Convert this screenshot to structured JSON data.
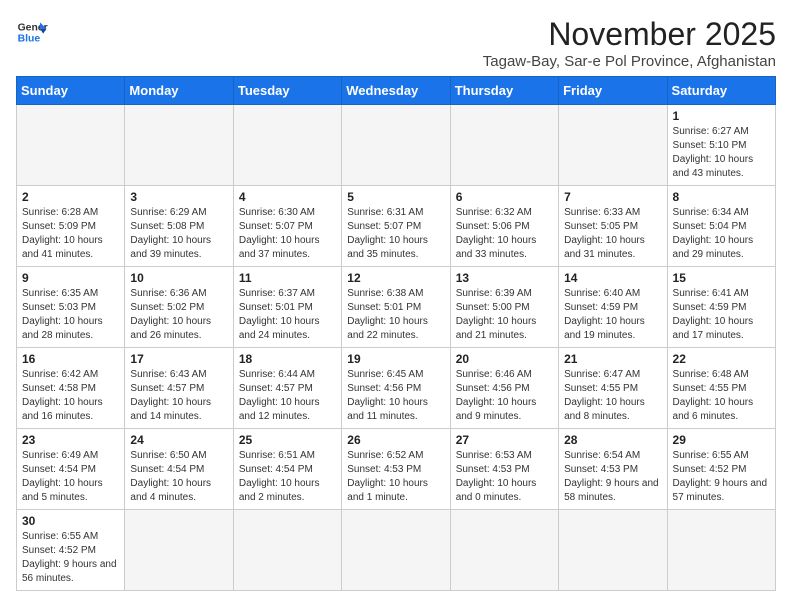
{
  "logo": {
    "line1": "General",
    "line2": "Blue"
  },
  "title": "November 2025",
  "subtitle": "Tagaw-Bay, Sar-e Pol Province, Afghanistan",
  "weekdays": [
    "Sunday",
    "Monday",
    "Tuesday",
    "Wednesday",
    "Thursday",
    "Friday",
    "Saturday"
  ],
  "weeks": [
    [
      {
        "day": "",
        "info": ""
      },
      {
        "day": "",
        "info": ""
      },
      {
        "day": "",
        "info": ""
      },
      {
        "day": "",
        "info": ""
      },
      {
        "day": "",
        "info": ""
      },
      {
        "day": "",
        "info": ""
      },
      {
        "day": "1",
        "info": "Sunrise: 6:27 AM\nSunset: 5:10 PM\nDaylight: 10 hours and 43 minutes."
      }
    ],
    [
      {
        "day": "2",
        "info": "Sunrise: 6:28 AM\nSunset: 5:09 PM\nDaylight: 10 hours and 41 minutes."
      },
      {
        "day": "3",
        "info": "Sunrise: 6:29 AM\nSunset: 5:08 PM\nDaylight: 10 hours and 39 minutes."
      },
      {
        "day": "4",
        "info": "Sunrise: 6:30 AM\nSunset: 5:07 PM\nDaylight: 10 hours and 37 minutes."
      },
      {
        "day": "5",
        "info": "Sunrise: 6:31 AM\nSunset: 5:07 PM\nDaylight: 10 hours and 35 minutes."
      },
      {
        "day": "6",
        "info": "Sunrise: 6:32 AM\nSunset: 5:06 PM\nDaylight: 10 hours and 33 minutes."
      },
      {
        "day": "7",
        "info": "Sunrise: 6:33 AM\nSunset: 5:05 PM\nDaylight: 10 hours and 31 minutes."
      },
      {
        "day": "8",
        "info": "Sunrise: 6:34 AM\nSunset: 5:04 PM\nDaylight: 10 hours and 29 minutes."
      }
    ],
    [
      {
        "day": "9",
        "info": "Sunrise: 6:35 AM\nSunset: 5:03 PM\nDaylight: 10 hours and 28 minutes."
      },
      {
        "day": "10",
        "info": "Sunrise: 6:36 AM\nSunset: 5:02 PM\nDaylight: 10 hours and 26 minutes."
      },
      {
        "day": "11",
        "info": "Sunrise: 6:37 AM\nSunset: 5:01 PM\nDaylight: 10 hours and 24 minutes."
      },
      {
        "day": "12",
        "info": "Sunrise: 6:38 AM\nSunset: 5:01 PM\nDaylight: 10 hours and 22 minutes."
      },
      {
        "day": "13",
        "info": "Sunrise: 6:39 AM\nSunset: 5:00 PM\nDaylight: 10 hours and 21 minutes."
      },
      {
        "day": "14",
        "info": "Sunrise: 6:40 AM\nSunset: 4:59 PM\nDaylight: 10 hours and 19 minutes."
      },
      {
        "day": "15",
        "info": "Sunrise: 6:41 AM\nSunset: 4:59 PM\nDaylight: 10 hours and 17 minutes."
      }
    ],
    [
      {
        "day": "16",
        "info": "Sunrise: 6:42 AM\nSunset: 4:58 PM\nDaylight: 10 hours and 16 minutes."
      },
      {
        "day": "17",
        "info": "Sunrise: 6:43 AM\nSunset: 4:57 PM\nDaylight: 10 hours and 14 minutes."
      },
      {
        "day": "18",
        "info": "Sunrise: 6:44 AM\nSunset: 4:57 PM\nDaylight: 10 hours and 12 minutes."
      },
      {
        "day": "19",
        "info": "Sunrise: 6:45 AM\nSunset: 4:56 PM\nDaylight: 10 hours and 11 minutes."
      },
      {
        "day": "20",
        "info": "Sunrise: 6:46 AM\nSunset: 4:56 PM\nDaylight: 10 hours and 9 minutes."
      },
      {
        "day": "21",
        "info": "Sunrise: 6:47 AM\nSunset: 4:55 PM\nDaylight: 10 hours and 8 minutes."
      },
      {
        "day": "22",
        "info": "Sunrise: 6:48 AM\nSunset: 4:55 PM\nDaylight: 10 hours and 6 minutes."
      }
    ],
    [
      {
        "day": "23",
        "info": "Sunrise: 6:49 AM\nSunset: 4:54 PM\nDaylight: 10 hours and 5 minutes."
      },
      {
        "day": "24",
        "info": "Sunrise: 6:50 AM\nSunset: 4:54 PM\nDaylight: 10 hours and 4 minutes."
      },
      {
        "day": "25",
        "info": "Sunrise: 6:51 AM\nSunset: 4:54 PM\nDaylight: 10 hours and 2 minutes."
      },
      {
        "day": "26",
        "info": "Sunrise: 6:52 AM\nSunset: 4:53 PM\nDaylight: 10 hours and 1 minute."
      },
      {
        "day": "27",
        "info": "Sunrise: 6:53 AM\nSunset: 4:53 PM\nDaylight: 10 hours and 0 minutes."
      },
      {
        "day": "28",
        "info": "Sunrise: 6:54 AM\nSunset: 4:53 PM\nDaylight: 9 hours and 58 minutes."
      },
      {
        "day": "29",
        "info": "Sunrise: 6:55 AM\nSunset: 4:52 PM\nDaylight: 9 hours and 57 minutes."
      }
    ],
    [
      {
        "day": "30",
        "info": "Sunrise: 6:55 AM\nSunset: 4:52 PM\nDaylight: 9 hours and 56 minutes."
      },
      {
        "day": "",
        "info": ""
      },
      {
        "day": "",
        "info": ""
      },
      {
        "day": "",
        "info": ""
      },
      {
        "day": "",
        "info": ""
      },
      {
        "day": "",
        "info": ""
      },
      {
        "day": "",
        "info": ""
      }
    ]
  ]
}
